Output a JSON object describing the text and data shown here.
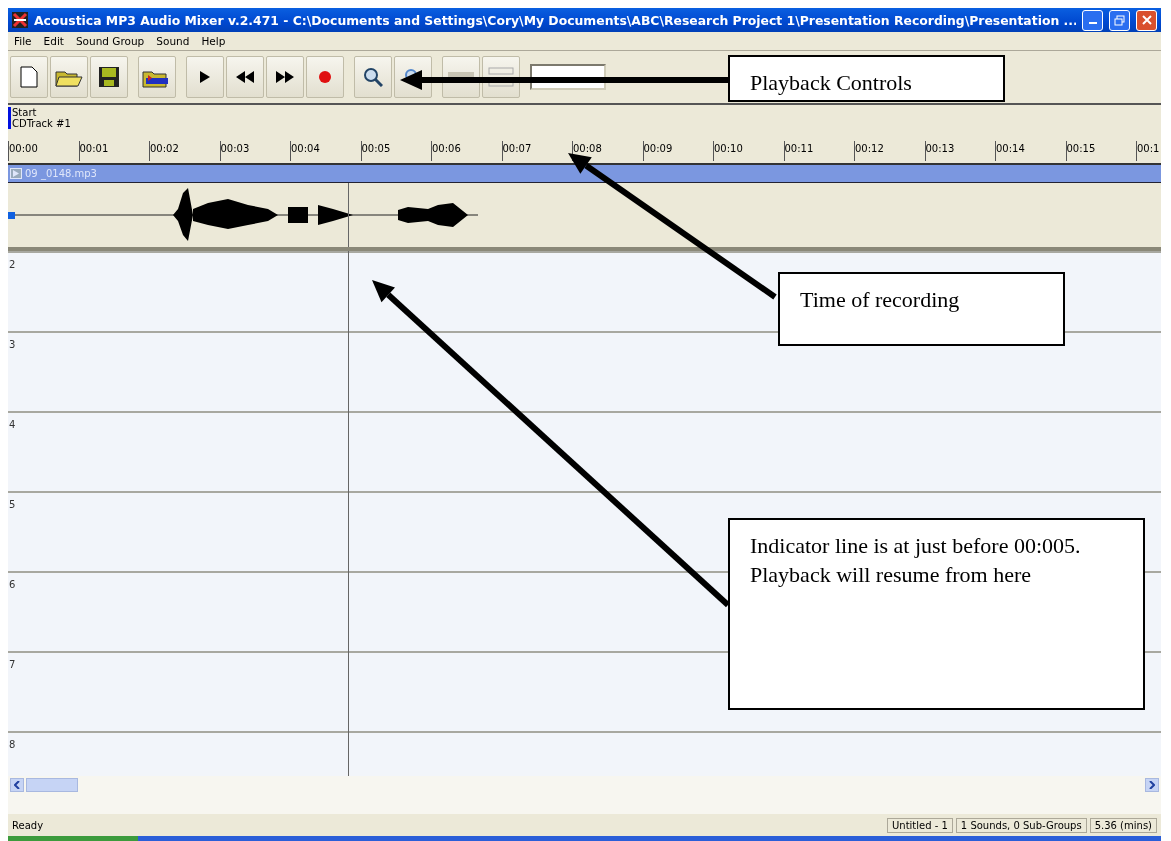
{
  "window": {
    "title": "Acoustica MP3 Audio Mixer v.2.471 - C:\\Documents and Settings\\Cory\\My Documents\\ABC\\Research Project 1\\Presentation Recording\\Presentation ..."
  },
  "menu": [
    "File",
    "Edit",
    "Sound Group",
    "Sound",
    "Help"
  ],
  "toolbar": [
    [
      {
        "kind": "new"
      },
      {
        "kind": "open"
      },
      {
        "kind": "save"
      }
    ],
    [
      {
        "kind": "import"
      }
    ],
    [
      {
        "kind": "play"
      },
      {
        "kind": "rewind"
      },
      {
        "kind": "forward"
      },
      {
        "kind": "record"
      }
    ],
    [
      {
        "kind": "zoom-in"
      },
      {
        "kind": "zoom-out"
      }
    ],
    [
      {
        "kind": "bar"
      },
      {
        "kind": "grid"
      }
    ]
  ],
  "timeline": {
    "markers": [
      "Start",
      "CDTrack #1"
    ],
    "ticks": [
      "00:00",
      "00:01",
      "00:02",
      "00:03",
      "00:04",
      "00:05",
      "00:06",
      "00:07",
      "00:08",
      "00:09",
      "00:10",
      "00:11",
      "00:12",
      "00:13",
      "00:14",
      "00:15",
      "00:1"
    ]
  },
  "clip": {
    "name": "09 _0148.mp3"
  },
  "tracks": [
    "2",
    "3",
    "4",
    "5",
    "6",
    "7",
    "8"
  ],
  "status_bar": {
    "message": "Ready",
    "panels": [
      "Untitled - 1",
      "1 Sounds, 0 Sub-Groups",
      "5.36 (mins)"
    ]
  },
  "annotations": [
    {
      "text": "Playback Controls",
      "kind": "controls"
    },
    {
      "text": "Time of recording",
      "kind": "time"
    },
    {
      "text": "Indicator line is at just before 00:005.  Playback will resume from here",
      "kind": "indicator"
    }
  ]
}
